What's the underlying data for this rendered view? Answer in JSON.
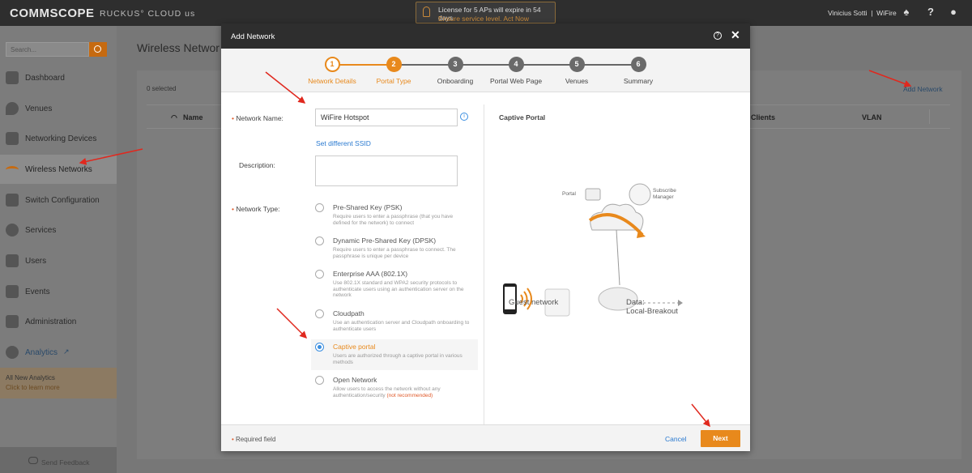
{
  "topbar": {
    "brand": "COMMSCOPE",
    "product": "RUCKUS",
    "product_suffix": "CLOUD us",
    "license_line1": "License for 5 APs will expire in 54 days",
    "license_line2": "Ensure service level. Act Now",
    "user": "Vinicius Sotti",
    "tenant": "WiFire"
  },
  "sidebar": {
    "search_placeholder": "Search...",
    "items": [
      {
        "label": "Dashboard",
        "icon": "dashboard-icon"
      },
      {
        "label": "Venues",
        "icon": "location-pin-icon"
      },
      {
        "label": "Networking Devices",
        "icon": "devices-icon"
      },
      {
        "label": "Wireless Networks",
        "icon": "wifi-icon"
      },
      {
        "label": "Switch Configuration",
        "icon": "switch-icon"
      },
      {
        "label": "Services",
        "icon": "gear-icon"
      },
      {
        "label": "Users",
        "icon": "user-icon"
      },
      {
        "label": "Events",
        "icon": "events-icon"
      },
      {
        "label": "Administration",
        "icon": "wrench-icon"
      },
      {
        "label": "Analytics",
        "icon": "pie-chart-icon"
      }
    ],
    "promo_title": "All New Analytics",
    "promo_link": "Click to learn more",
    "feedback": "Send Feedback"
  },
  "main": {
    "page_title": "Wireless Networ",
    "selected": "0 selected",
    "add_network": "Add Network",
    "columns": {
      "name": "Name",
      "clients": "Clients",
      "vlan": "VLAN"
    }
  },
  "modal": {
    "title": "Add Network",
    "help": "?",
    "close": "✕",
    "steps": [
      {
        "num": "1",
        "label": "Network Details",
        "state": "done"
      },
      {
        "num": "2",
        "label": "Portal Type",
        "state": "current"
      },
      {
        "num": "3",
        "label": "Onboarding",
        "state": "todo"
      },
      {
        "num": "4",
        "label": "Portal Web Page",
        "state": "todo"
      },
      {
        "num": "5",
        "label": "Venues",
        "state": "todo"
      },
      {
        "num": "6",
        "label": "Summary",
        "state": "todo"
      }
    ],
    "form": {
      "network_name_label": "Network Name:",
      "network_name_value": "WiFire Hotspot",
      "set_ssid": "Set different SSID",
      "description_label": "Description:",
      "description_value": "",
      "network_type_label": "Network Type:",
      "options": [
        {
          "title": "Pre-Shared Key (PSK)",
          "desc": "Require users to enter a passphrase (that you have defined for the network) to connect",
          "selected": false
        },
        {
          "title": "Dynamic Pre-Shared Key (DPSK)",
          "desc": "Require users to enter a passphrase to connect. The passphrase is unique per device",
          "selected": false
        },
        {
          "title": "Enterprise AAA (802.1X)",
          "desc": "Use 802.1X standard and WPA2 security protocols to authenticate users using an authentication server on the network",
          "selected": false
        },
        {
          "title": "Cloudpath",
          "desc": "Use an authentication server and Cloudpath onboarding to authenticate users",
          "selected": false
        },
        {
          "title": "Captive portal",
          "desc": "Users are authorized through a captive portal in various methods",
          "selected": true
        },
        {
          "title": "Open Network",
          "desc": "Allow users to access the network without any authentication/security",
          "desc_note": "(not recommended)",
          "selected": false
        }
      ]
    },
    "preview": {
      "title": "Captive Portal",
      "portal": "Portal",
      "subscribe": "Subscribe",
      "manager": "Manager",
      "guest": "Guest network",
      "data_line1": "Data:",
      "data_line2": "Local-Breakout"
    },
    "footer": {
      "required": "Required field",
      "cancel": "Cancel",
      "next": "Next"
    }
  },
  "colors": {
    "accent": "#e8891c",
    "link": "#2a7ad0",
    "annotation": "#e0281e"
  }
}
